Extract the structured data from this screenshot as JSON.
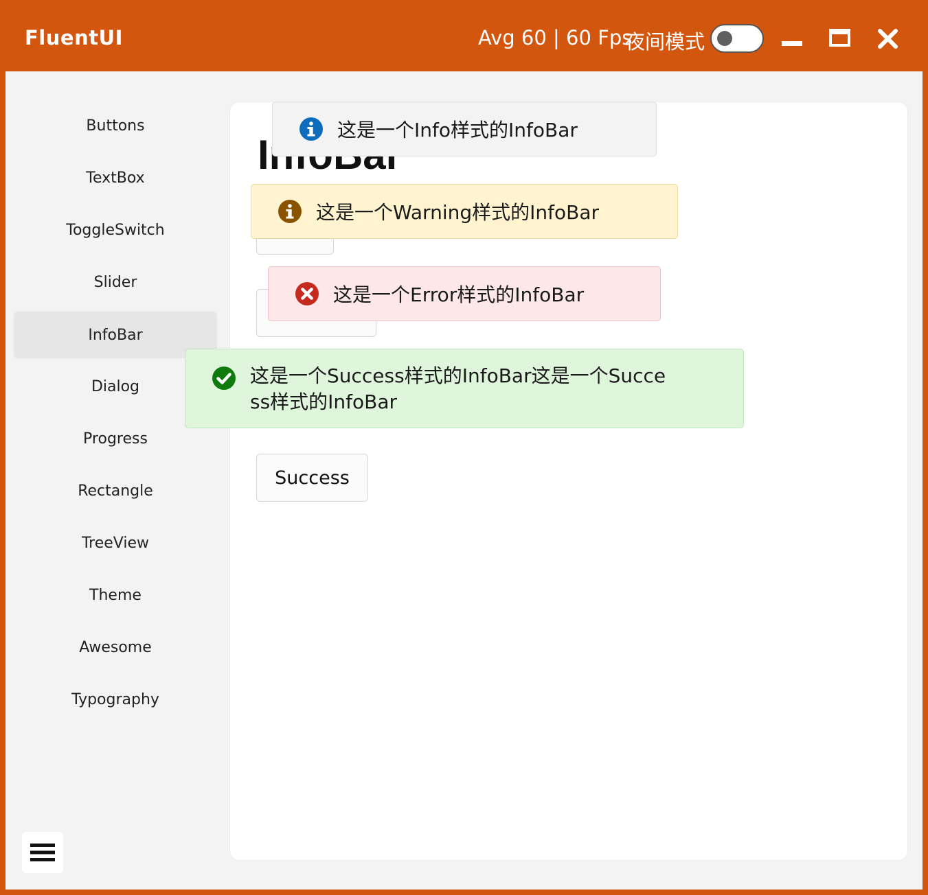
{
  "titlebar": {
    "app_title": "FluentUI",
    "fps": "Avg 60 | 60 Fps",
    "night_mode_label": "夜间模式",
    "night_mode_on": false
  },
  "sidebar": {
    "items": [
      {
        "label": "Buttons"
      },
      {
        "label": "TextBox"
      },
      {
        "label": "ToggleSwitch"
      },
      {
        "label": "Slider"
      },
      {
        "label": "InfoBar",
        "active": true
      },
      {
        "label": "Dialog"
      },
      {
        "label": "Progress"
      },
      {
        "label": "Rectangle"
      },
      {
        "label": "TreeView"
      },
      {
        "label": "Theme"
      },
      {
        "label": "Awesome"
      },
      {
        "label": "Typography"
      }
    ]
  },
  "main": {
    "title": "InfoBar",
    "success_button": "Success"
  },
  "infobars": {
    "info": "这是一个Info样式的InfoBar",
    "warning": "这是一个Warning样式的InfoBar",
    "error": "这是一个Error样式的InfoBar",
    "success": "这是一个Success样式的InfoBar这是一个Success样式的InfoBar"
  },
  "colors": {
    "accent": "#d3560f",
    "info": "#0f6cbd",
    "warning": "#8a5300",
    "error": "#c42b1c",
    "success": "#0f7b0f"
  }
}
